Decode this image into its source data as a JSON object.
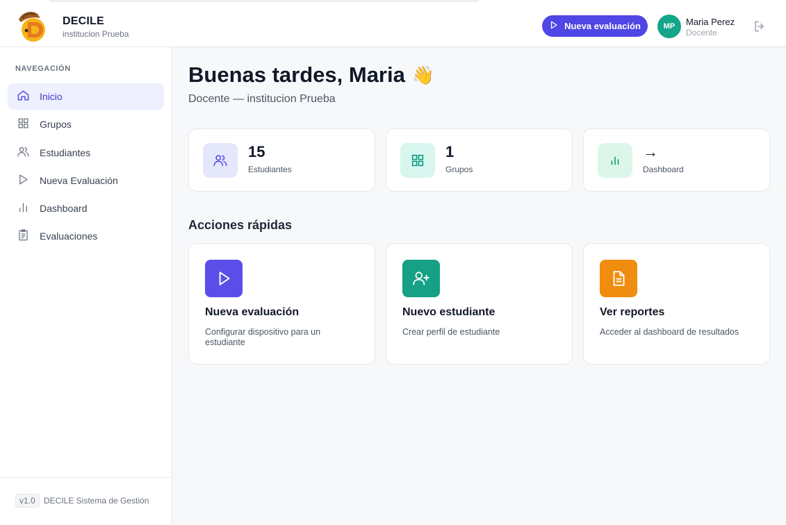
{
  "header": {
    "brand_name": "DECILE",
    "brand_sub": "institucion Prueba",
    "new_eval_label": "Nueva evaluación",
    "user_initials": "MP",
    "user_name": "Maria Perez",
    "user_role": "Docente"
  },
  "sidebar": {
    "title": "NAVEGACIÓN",
    "items": [
      {
        "label": "Inicio",
        "icon": "home-icon",
        "active": true
      },
      {
        "label": "Grupos",
        "icon": "grid-icon"
      },
      {
        "label": "Estudiantes",
        "icon": "users-icon"
      },
      {
        "label": "Nueva Evaluación",
        "icon": "play-icon"
      },
      {
        "label": "Dashboard",
        "icon": "bar-chart-icon"
      },
      {
        "label": "Evaluaciones",
        "icon": "clipboard-icon"
      }
    ],
    "version": "v1.0",
    "footer": "DECILE Sistema de Gestión"
  },
  "main": {
    "greeting": "Buenas tardes, Maria",
    "greeting_emoji": "👋",
    "subline": "Docente — institucion Prueba",
    "stats": [
      {
        "value": "15",
        "label": "Estudiantes",
        "icon": "users-icon",
        "bg": "#e5e7fb",
        "fg": "#4f46e5"
      },
      {
        "value": "1",
        "label": "Grupos",
        "icon": "grid-icon",
        "bg": "#d8f5ee",
        "fg": "#0f9f84"
      },
      {
        "value": "→",
        "label": "Dashboard",
        "icon": "bar-chart-icon",
        "bg": "#dcf6ea",
        "fg": "#12a06d"
      }
    ],
    "quick_actions_title": "Acciones rápidas",
    "actions": [
      {
        "title": "Nueva evaluación",
        "desc": "Configurar dispositivo para un estudiante",
        "icon": "play-icon",
        "bg": "#5b4ee8"
      },
      {
        "title": "Nuevo estudiante",
        "desc": "Crear perfil de estudiante",
        "icon": "user-plus-icon",
        "bg": "#16a085"
      },
      {
        "title": "Ver reportes",
        "desc": "Acceder al dashboard de resultados",
        "icon": "file-text-icon",
        "bg": "#f08c0f"
      }
    ]
  },
  "colors": {
    "accent": "#4f46e5",
    "avatar": "#14a58a"
  }
}
